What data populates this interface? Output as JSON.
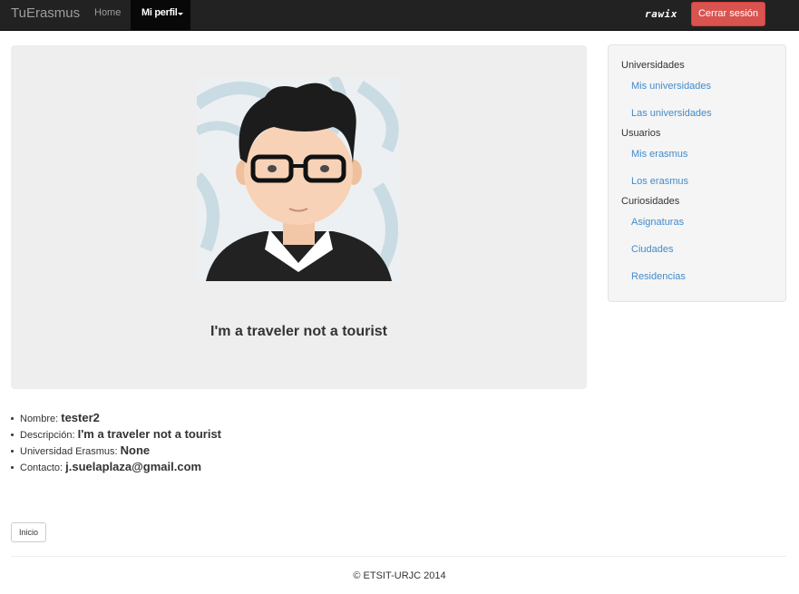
{
  "navbar": {
    "brand": "TuErasmus",
    "home": "Home",
    "profile": "Mi perfil",
    "user": "rawix",
    "logout": "Cerrar sesión"
  },
  "profile": {
    "tagline": "I'm a traveler not a tourist"
  },
  "sidebar": {
    "groups": [
      {
        "title": "Universidades",
        "links": [
          "Mis universidades",
          "Las universidades"
        ]
      },
      {
        "title": "Usuarios",
        "links": [
          "Mis erasmus",
          "Los erasmus"
        ]
      },
      {
        "title": "Curiosidades",
        "links": [
          "Asignaturas",
          "Ciudades",
          "Residencias"
        ]
      }
    ]
  },
  "info": {
    "name_label": "Nombre:",
    "name_value": "tester2",
    "desc_label": "Descripción:",
    "desc_value": "I'm a traveler not a tourist",
    "uni_label": "Universidad Erasmus:",
    "uni_value": "None",
    "contact_label": "Contacto:",
    "contact_value": "j.suelaplaza@gmail.com"
  },
  "buttons": {
    "inicio": "Inicio"
  },
  "footer": "© ETSIT-URJC 2014"
}
